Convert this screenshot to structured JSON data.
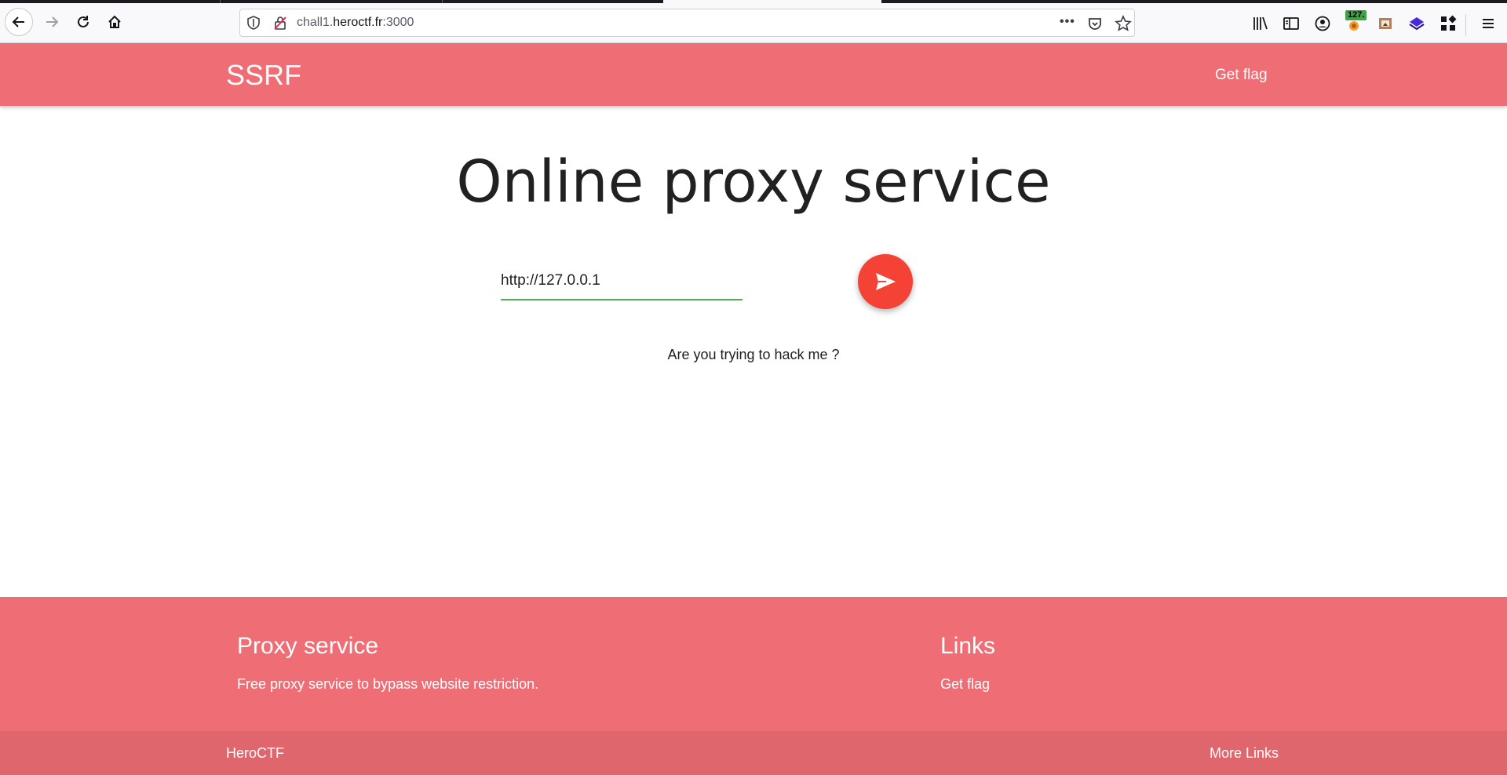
{
  "browser": {
    "url_prefix": "chall1.",
    "url_host": "heroctf.fr",
    "url_suffix": ":3000",
    "more_label": "•••",
    "extension_badge": "127.",
    "icons": [
      "back-icon",
      "forward-icon",
      "reload-icon",
      "home-icon",
      "shield-icon",
      "insecure-lock-icon",
      "pocket-icon",
      "bookmark-star-icon",
      "library-icon",
      "sidebar-icon",
      "account-icon",
      "extension-icon",
      "screenshot-icon",
      "layers-extension-icon",
      "apps-grid-icon",
      "hamburger-menu-icon"
    ]
  },
  "navbar": {
    "brand": "SSRF",
    "link": "Get flag",
    "color": "#ef6d74"
  },
  "main": {
    "title": "Online proxy service",
    "input_value": "http://127.0.0.1",
    "send_icon": "send-icon",
    "send_color": "#f44336",
    "input_underline_color": "#4caf50",
    "result": "Are you trying to hack me ?"
  },
  "footer": {
    "about_title": "Proxy service",
    "about_text": "Free proxy service to bypass website restriction.",
    "links_title": "Links",
    "links_item": "Get flag",
    "copyright": "HeroCTF",
    "more_links": "More Links"
  }
}
